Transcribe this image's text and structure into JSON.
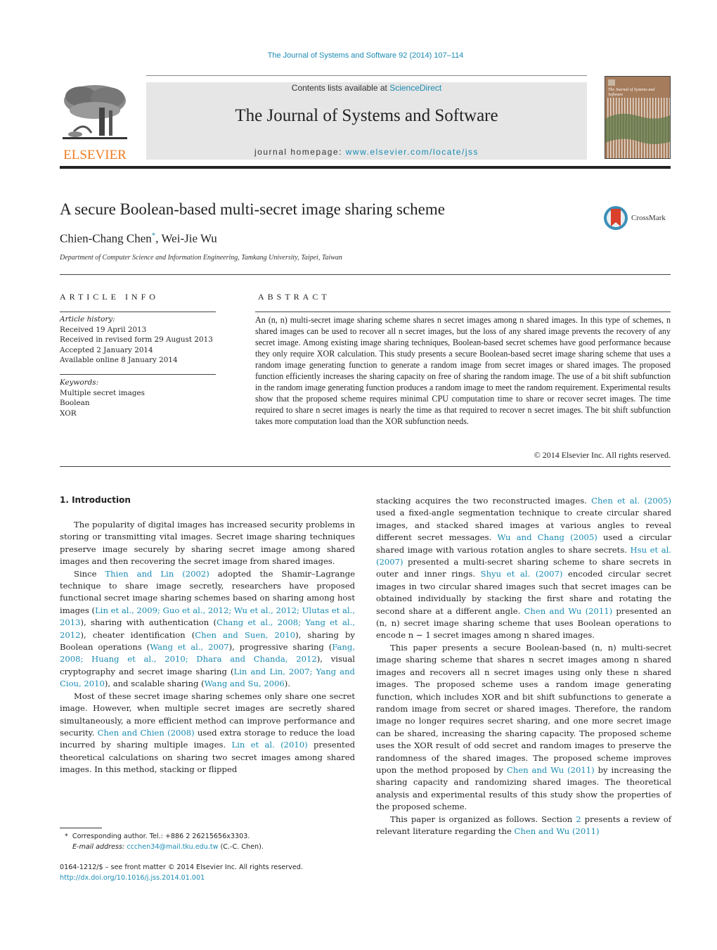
{
  "header": {
    "journal_reference": "The Journal of Systems and Software 92 (2014) 107–114",
    "contents_prefix": "Contents lists available at ",
    "contents_link": "ScienceDirect",
    "journal_title": "The Journal of Systems and Software",
    "homepage_prefix": "journal homepage: ",
    "homepage_link": "www.elsevier.com/locate/jss",
    "publisher_logo_text": "ELSEVIER",
    "cover_title": "The Journal of Systems and Software"
  },
  "article": {
    "title": "A secure Boolean-based multi-secret image sharing scheme",
    "crossmark_label": "CrossMark",
    "author_1": "Chien-Chang Chen",
    "author_marker": "*",
    "author_sep": ", ",
    "author_2": "Wei-Jie Wu",
    "affiliation": "Department of Computer Science and Information Engineering, Tamkang University, Taipei, Taiwan"
  },
  "article_info": {
    "heading": "ARTICLE INFO",
    "history_label": "Article history:",
    "history": [
      "Received 19 April 2013",
      "Received in revised form 29 August 2013",
      "Accepted 2 January 2014",
      "Available online 8 January 2014"
    ],
    "keywords_label": "Keywords:",
    "keywords": [
      "Multiple secret images",
      "Boolean",
      "XOR"
    ]
  },
  "abstract": {
    "heading": "ABSTRACT",
    "text": "An (n, n) multi-secret image sharing scheme shares n secret images among n shared images. In this type of schemes, n shared images can be used to recover all n secret images, but the loss of any shared image prevents the recovery of any secret image. Among existing image sharing techniques, Boolean-based secret schemes have good performance because they only require XOR calculation. This study presents a secure Boolean-based secret image sharing scheme that uses a random image generating function to generate a random image from secret images or shared images. The proposed function efficiently increases the sharing capacity on free of sharing the random image. The use of a bit shift subfunction in the random image generating function produces a random image to meet the random requirement. Experimental results show that the proposed scheme requires minimal CPU computation time to share or recover secret images. The time required to share n secret images is nearly the time as that required to recover n secret images. The bit shift subfunction takes more computation load than the XOR subfunction needs.",
    "copyright": "© 2014 Elsevier Inc. All rights reserved."
  },
  "intro": {
    "heading": "1.  Introduction",
    "p1": "The popularity of digital images has increased security problems in storing or transmitting vital images. Secret image sharing techniques preserve image securely by sharing secret image among shared images and then recovering the secret image from shared images.",
    "p2": [
      {
        "t": "Since "
      },
      {
        "l": "Thien and Lin (2002)"
      },
      {
        "t": " adopted the Shamir–Lagrange technique to share image secretly, researchers have proposed functional secret image sharing schemes based on sharing among host images ("
      },
      {
        "l": "Lin et al., 2009; Guo et al., 2012; Wu et al., 2012; Ulutas et al., 2013"
      },
      {
        "t": "), sharing with authentication ("
      },
      {
        "l": "Chang et al., 2008; Yang et al., 2012"
      },
      {
        "t": "), cheater identification ("
      },
      {
        "l": "Chen and Suen, 2010"
      },
      {
        "t": "), sharing by Boolean operations ("
      },
      {
        "l": "Wang et al., 2007"
      },
      {
        "t": "), progressive sharing ("
      },
      {
        "l": "Fang, 2008; Huang et al., 2010; Dhara and Chanda, 2012"
      },
      {
        "t": "), visual cryptography and secret image sharing ("
      },
      {
        "l": "Lin and Lin, 2007; Yang and Ciou, 2010"
      },
      {
        "t": "), and scalable sharing ("
      },
      {
        "l": "Wang and Su, 2006"
      },
      {
        "t": ")."
      }
    ],
    "p3": [
      {
        "t": "Most of these secret image sharing schemes only share one secret image. However, when multiple secret images are secretly shared simultaneously, a more efficient method can improve performance and security. "
      },
      {
        "l": "Chen and Chien (2008)"
      },
      {
        "t": " used extra storage to reduce the load incurred by sharing multiple images. "
      },
      {
        "l": "Lin et al. (2010)"
      },
      {
        "t": " presented theoretical calculations on sharing two secret images among shared images. In this method, stacking or flipped stacking acquires the two reconstructed images. "
      },
      {
        "l": "Chen et al. (2005)"
      },
      {
        "t": " used a fixed-angle segmentation technique to create circular shared images, and stacked shared images at various angles to reveal different secret messages. "
      },
      {
        "l": "Wu and Chang (2005)"
      },
      {
        "t": " used a circular shared image with various rotation angles to share secrets. "
      },
      {
        "l": "Hsu et al. (2007)"
      },
      {
        "t": " presented a multi-secret sharing scheme to share secrets in outer and inner rings. "
      },
      {
        "l": "Shyu et al. (2007)"
      },
      {
        "t": " encoded circular secret images in two circular shared images such that secret images can be obtained individually by stacking the first share and rotating the second share at a different angle. "
      },
      {
        "l": "Chen and Wu (2011)"
      },
      {
        "t": " presented an (n, n) secret image sharing scheme that uses Boolean operations to encode n − 1 secret images among n shared images."
      }
    ],
    "p4": [
      {
        "t": "This paper presents a secure Boolean-based (n, n) multi-secret image sharing scheme that shares n secret images among n shared images and recovers all n secret images using only these n shared images. The proposed scheme uses a random image generating function, which includes XOR and bit shift subfunctions to generate a random image from secret or shared images. Therefore, the random image no longer requires secret sharing, and one more secret image can be shared, increasing the sharing capacity. The proposed scheme uses the XOR result of odd secret and random images to preserve the randomness of the shared images. The proposed scheme improves upon the method proposed by "
      },
      {
        "l": "Chen and Wu (2011)"
      },
      {
        "t": " by increasing the sharing capacity and randomizing shared images. The theoretical analysis and experimental results of this study show the properties of the proposed scheme."
      }
    ],
    "p5": [
      {
        "t": "This paper is organized as follows. Section "
      },
      {
        "l": "2"
      },
      {
        "t": " presents a review of relevant literature regarding the "
      },
      {
        "l": "Chen and Wu (2011)"
      }
    ]
  },
  "footnote": {
    "marker": "*",
    "line1": "Corresponding author. Tel.: +886 2 26215656x3303.",
    "email_label": "E-mail address:",
    "email": "ccchen34@mail.tku.edu.tw",
    "email_suffix": " (C.-C. Chen)."
  },
  "front_matter": {
    "issn_line": "0164-1212/$ – see front matter © 2014 Elsevier Inc. All rights reserved.",
    "doi": "http://dx.doi.org/10.1016/j.jss.2014.01.001"
  },
  "colors": {
    "link": "#1a8bb3",
    "elsevier_orange": "#f07c22",
    "header_gray": "#e6e6e6",
    "cover_brown": "#a57c5c",
    "crossmark_red": "#d9412c"
  }
}
